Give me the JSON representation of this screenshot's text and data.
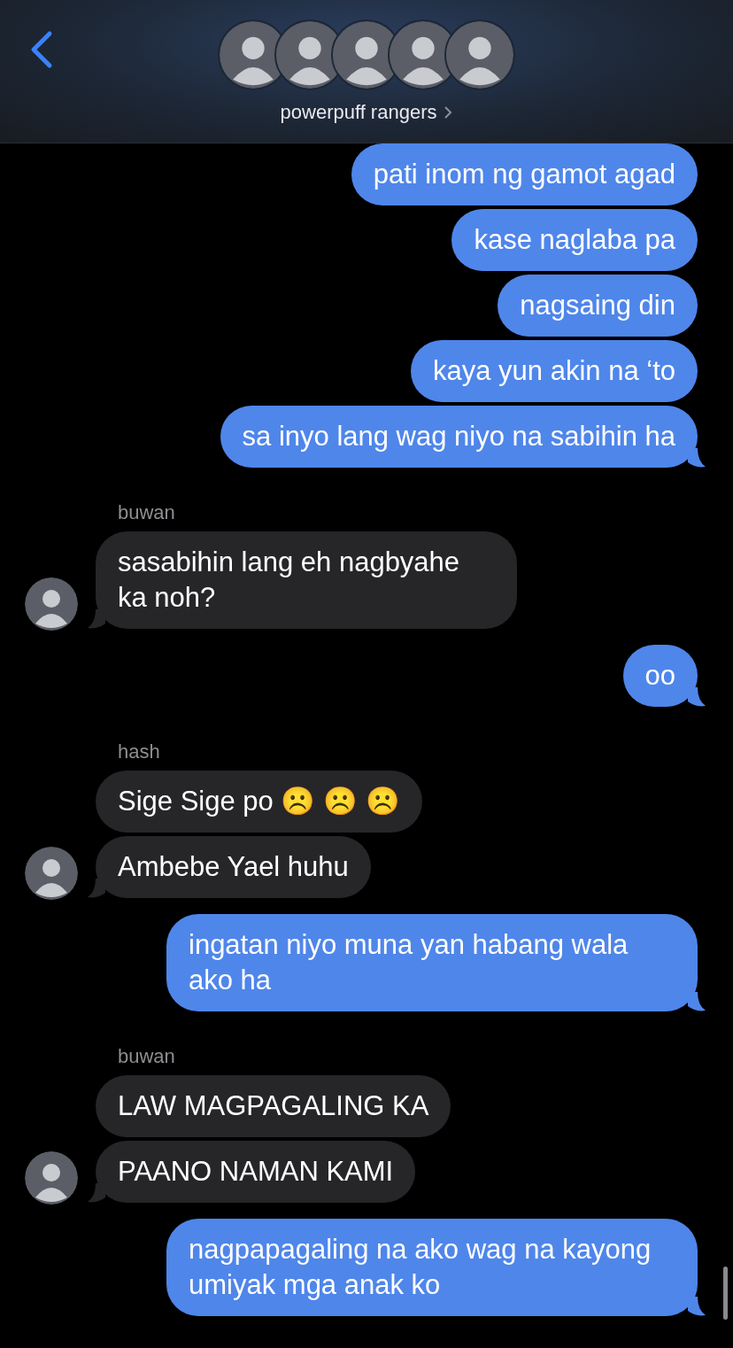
{
  "header": {
    "title": "powerpuff rangers"
  },
  "groups": [
    {
      "kind": "sent",
      "messages": [
        {
          "text": "pati inom ng gamot agad",
          "tail": false
        },
        {
          "text": "kase naglaba pa",
          "tail": false
        },
        {
          "text": "nagsaing din",
          "tail": false
        },
        {
          "text": "kaya yun akin na ‘to",
          "tail": false
        },
        {
          "text": "sa inyo lang wag niyo na sabihin ha",
          "tail": true
        }
      ]
    },
    {
      "kind": "received",
      "sender": "buwan",
      "messages": [
        {
          "text": "sasabihin lang eh nagbyahe ka noh?",
          "tail": true
        }
      ]
    },
    {
      "kind": "sent",
      "messages": [
        {
          "text": "oo",
          "tail": true
        }
      ]
    },
    {
      "kind": "received",
      "sender": "hash",
      "messages": [
        {
          "text": "Sige Sige po ☹️ ☹️ ☹️",
          "tail": false
        },
        {
          "text": "Ambebe Yael huhu",
          "tail": true
        }
      ]
    },
    {
      "kind": "sent",
      "messages": [
        {
          "text": "ingatan niyo muna yan habang wala ako ha",
          "tail": true
        }
      ]
    },
    {
      "kind": "received",
      "sender": "buwan",
      "messages": [
        {
          "text": "LAW MAGPAGALING KA",
          "tail": false
        },
        {
          "text": "PAANO NAMAN KAMI",
          "tail": true
        }
      ]
    },
    {
      "kind": "sent",
      "messages": [
        {
          "text": "nagpapagaling na ako wag na kayong umiyak mga anak ko",
          "tail": true
        }
      ]
    }
  ]
}
